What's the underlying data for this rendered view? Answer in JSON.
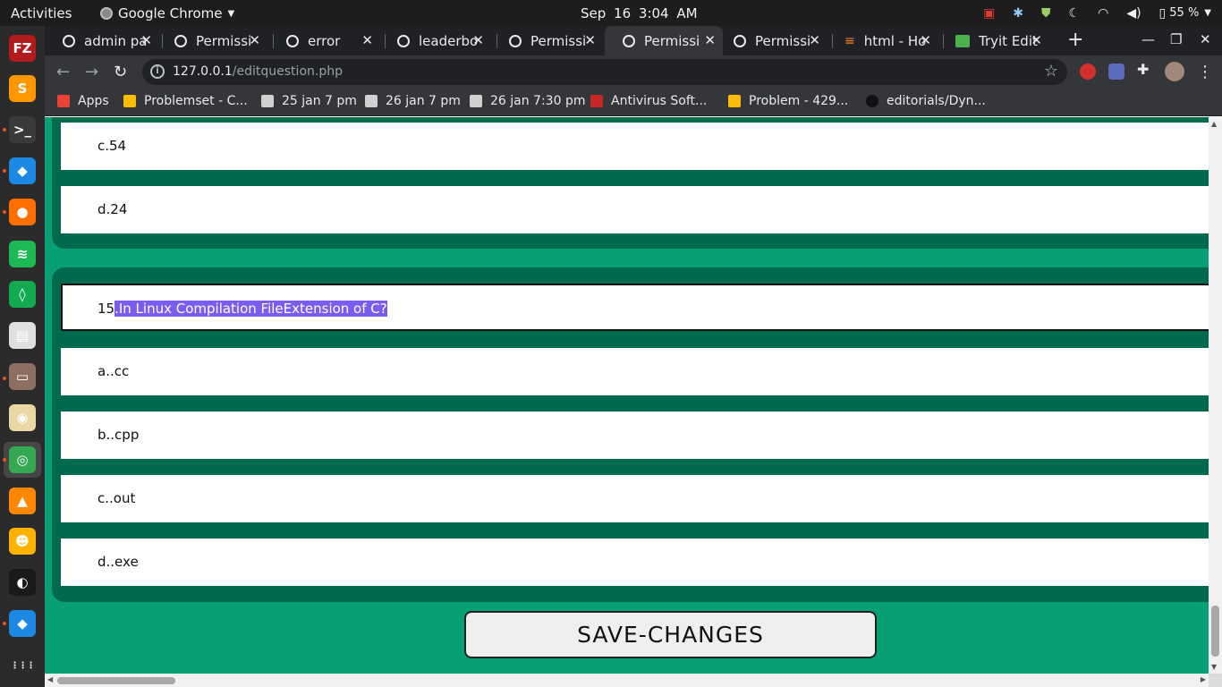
{
  "topbar": {
    "activities": "Activities",
    "app_name": "Google Chrome",
    "clock": "Sep 16  3:04 AM",
    "battery": "55 %"
  },
  "dock": {
    "items": [
      {
        "name": "filezilla",
        "glyph": "FZ",
        "color": "#b11b1b"
      },
      {
        "name": "sublime-text",
        "glyph": "S",
        "color": "#ff9800"
      },
      {
        "name": "terminal",
        "glyph": ">_",
        "color": "#3a3a3a"
      },
      {
        "name": "vscode",
        "glyph": "◆",
        "color": "#1e88e5"
      },
      {
        "name": "firefox",
        "glyph": "●",
        "color": "#ff6f00"
      },
      {
        "name": "spotify",
        "glyph": "≋",
        "color": "#1db954"
      },
      {
        "name": "mongodb-compass",
        "glyph": "◊",
        "color": "#13aa52"
      },
      {
        "name": "document-viewer",
        "glyph": "▤",
        "color": "#e0e0e0"
      },
      {
        "name": "file-manager",
        "glyph": "▭",
        "color": "#8d6e63"
      },
      {
        "name": "rhythmbox",
        "glyph": "◉",
        "color": "#e9d8a6"
      },
      {
        "name": "chrome",
        "glyph": "◎",
        "color": "#34a853"
      },
      {
        "name": "vlc",
        "glyph": "▲",
        "color": "#ff8800"
      },
      {
        "name": "software-center",
        "glyph": "☻",
        "color": "#ffb300"
      },
      {
        "name": "obs",
        "glyph": "◐",
        "color": "#1a1a1a"
      },
      {
        "name": "vscode-2",
        "glyph": "◆",
        "color": "#1e88e5"
      },
      {
        "name": "show-applications",
        "glyph": "⋮⋮⋮",
        "color": "transparent"
      }
    ]
  },
  "tabs": [
    {
      "title": "admin pa"
    },
    {
      "title": "Permissi"
    },
    {
      "title": "error"
    },
    {
      "title": "leaderbo"
    },
    {
      "title": "Permissi"
    },
    {
      "title": "Permissi"
    },
    {
      "title": "Permissi"
    },
    {
      "title": "html - Ho"
    },
    {
      "title": "Tryit Edit"
    }
  ],
  "omnibox": {
    "host": "127.0.0.1",
    "path": "/editquestion.php"
  },
  "bookmarks": [
    {
      "label": "Apps",
      "color": "#ea4335"
    },
    {
      "label": "Problemset - C...",
      "color": "#fbbc05"
    },
    {
      "label": "25 jan 7 pm",
      "color": "#d0d0d0"
    },
    {
      "label": "26 jan 7 pm",
      "color": "#d0d0d0"
    },
    {
      "label": "26 jan 7:30 pm",
      "color": "#d0d0d0"
    },
    {
      "label": "Antivirus Soft...",
      "color": "#c62828"
    },
    {
      "label": "Problem - 429...",
      "color": "#fbbc05"
    },
    {
      "label": "editorials/Dyn...",
      "color": "#111111"
    }
  ],
  "page": {
    "question14_options": [
      {
        "text": "c.54"
      },
      {
        "text": "d.24"
      }
    ],
    "question15": {
      "number": "15",
      "selected_text": ".In Linux Compilation FileExtension of C?",
      "options": [
        {
          "text": "a..cc"
        },
        {
          "text": "b..cpp"
        },
        {
          "text": "c..out"
        },
        {
          "text": "d..exe"
        }
      ]
    },
    "save_button": "SAVE-CHANGES"
  },
  "colors": {
    "page_background": "#06a074",
    "block_background": "#006a4e",
    "selection": "#7b5cf0"
  }
}
